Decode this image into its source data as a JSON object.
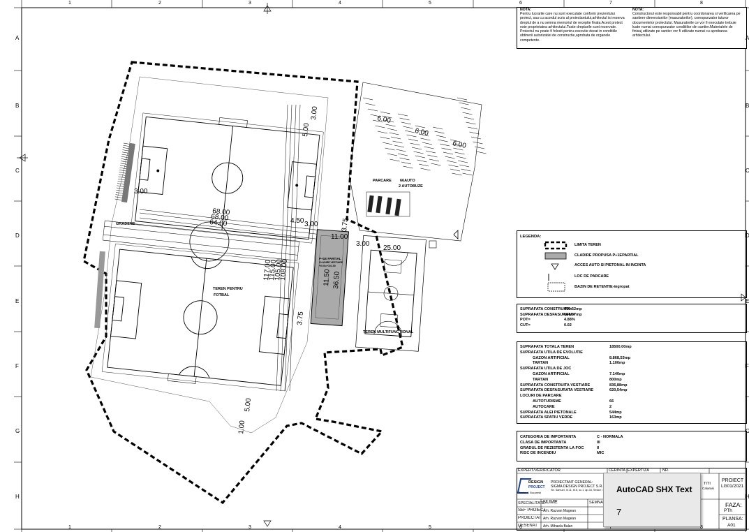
{
  "grid": {
    "columns": [
      "1",
      "2",
      "3",
      "4",
      "5",
      "6",
      "7",
      "8"
    ],
    "rows": [
      "A",
      "B",
      "C",
      "D",
      "E",
      "F",
      "G",
      "H"
    ]
  },
  "notes": {
    "left_heading": "NOTA:",
    "left_text": "Pentru lucrarile care nu sunt executate conform prezentului proiect, sau cu acordul scris al proiectantului,arhitectul isi rezerva  dreptul de a nu semna memoriul de receptie finala.Acest proiect este proprietatea arhitectului.Toate drepturile sunt rezervate. Proiectul nu poate fi folosit pentru executie decat in conditiile obtinerii autorizatiei de constructie,aprobata de organele competente.",
    "right_heading": "NOTA:",
    "right_text": "Constructorul este responsabil pentru coordonarea si verificarea pe santiere dimensiunilor (masuratorilor), corespunzator tuturor documentelor proiectului. Masuratorile ce vor fi executate trebuie luate numai corespunzator conditiilor din santier.Materialele de finisaj utilizate pe santier vor fi utilizate numai cu aprobarea arhitectului."
  },
  "plan": {
    "labels": {
      "parcare": "PARCARE",
      "auto": "66AUTO",
      "autobuze": "2 AUTOBUZE",
      "gradene": "GRADENE",
      "teren_fotbal_1": "TEREN PENTRU",
      "teren_fotbal_2": "FOTBAL",
      "teren_multi": "TEREN MULTIFUNCTIONAL",
      "cladire_1": "P+1E PARTIAL",
      "cladire_2": "CLADIRE VESTIARE",
      "cladire_3": "+0.00=+101.50"
    },
    "dims": {
      "d600a": "6.00",
      "d600b": "6.00",
      "d600c": "6.00",
      "d300a": "3.00",
      "d500a": "5.00",
      "d300b": "3.00",
      "d6800a": "68.00",
      "d6800b": "68.00",
      "d6400": "64.00",
      "d450": "4.50",
      "d300c": "3.00",
      "d375a": "3.75",
      "d1100": "11.00",
      "d300d": "3.00",
      "d2500": "25.00",
      "d11700": "117.00",
      "d11500": "115.00",
      "d10500": "105.00",
      "d10800": "108.00",
      "d1150": "11.50",
      "d3650": "36.50",
      "d375b": "3.75",
      "d500b": "5.00",
      "d100": "1.00"
    }
  },
  "legend": {
    "title": "LEGENDA:",
    "items": [
      {
        "label": "LIMITA TEREN",
        "symbol": "limit-icon"
      },
      {
        "label": "CLADIRE PROPUSA P+1EPARTIAL",
        "symbol": "building-icon"
      },
      {
        "label": "ACCES AUTO SI PIETONAL IN INCINTA",
        "symbol": "access-triangle-icon"
      },
      {
        "label": "LOC DE PARCARE",
        "symbol": "parking-line-icon"
      },
      {
        "label": "BAZIN DE RETENTIE-ingropat",
        "symbol": "basin-icon"
      }
    ]
  },
  "indicators": [
    {
      "label": "SUPRAFATA CONSTRUITA=",
      "value": "406.52mp"
    },
    {
      "label": "SUPRAFATA DESFASURATA=",
      "value": "654.67mp"
    },
    {
      "label": "POT=",
      "value": "4.88%"
    },
    {
      "label": "CUT=",
      "value": "0.02"
    }
  ],
  "surfaces": [
    {
      "label": "SUPRAFATA TOTALA TEREN",
      "value": "18500.00mp",
      "indent": false
    },
    {
      "label": "SUPRAFATA UTILA DE EVOLUTIE",
      "value": "",
      "indent": false
    },
    {
      "label": "GAZON ARTIFICIAL",
      "value": "8.868,53mp",
      "indent": true
    },
    {
      "label": "TARTAN",
      "value": "1.100mp",
      "indent": true
    },
    {
      "label": "SUPRAFATA UTILA DE JOC",
      "value": "",
      "indent": false
    },
    {
      "label": "GAZON ARTIFICIAL",
      "value": "7.140mp",
      "indent": true
    },
    {
      "label": "TARTAN",
      "value": "800mp",
      "indent": true
    },
    {
      "label": "SUPRAFATA CONSTRUITA VESTIARE",
      "value": "836,88mp",
      "indent": false
    },
    {
      "label": "SUPRAFATA DESFASURATA VESTIARE",
      "value": "620,54mp",
      "indent": false
    },
    {
      "label": "LOCURI DE PARCARE",
      "value": "",
      "indent": false
    },
    {
      "label": "AUTOTURISME",
      "value": "66",
      "indent": true
    },
    {
      "label": "AUTOCARE",
      "value": "2",
      "indent": true
    },
    {
      "label": "SUPRAFATA ALEI PIETONALE",
      "value": "544mp",
      "indent": false
    },
    {
      "label": "SUPRAFATA SPATIU VERDE",
      "value": "163mp",
      "indent": false
    }
  ],
  "classification": [
    {
      "label": "CATEGORIA DE IMPORTANTA",
      "value": "C - NORMALA"
    },
    {
      "label": "CLASA DE IMPORTANTA",
      "value": "III"
    },
    {
      "label": "GRADUL DE REZISTENTA LA FOC",
      "value": "II"
    },
    {
      "label": "RISC DE INCENDIU",
      "value": "MIC"
    }
  ],
  "title_block": {
    "expert": "EXPERT/VERIFICATOR",
    "cerinta": "CERINTA",
    "expertiza": "EXPERTIZA",
    "nr": "NR.",
    "proiectant_general": "PROIECTANT GENERAL:",
    "company": "SIGMA DESIGN PROJECT S.R.L.",
    "address": "Str. Samuel, nr.11, bl.6, sc.1, ap.34, Sector 4, B",
    "logo_name": "DESIGN",
    "logo_sub": "PROJECT",
    "logo_tag": "Sector 4, Bucuresti",
    "titlu_fragment": "TITI",
    "titlu_fragment2": "Calarasi",
    "proiect_label": "PROIECT",
    "proiect_value": "LG01/2021",
    "specialitate": "SPECIALITATE",
    "nume": "NUME",
    "semnatura": "SEMNAT",
    "sef_proiect": "SEF PROIECT",
    "sef_proiect_name": "Arh. Razvan Magean",
    "proiectat": "PROIECTAT",
    "proiectat_name": "Arh. Razvan Magean",
    "desenat": "DESENAT",
    "desenat_name": "Arh. Mihaela Balan",
    "faza_label": "FAZA:",
    "faza_value": "PTh",
    "plansa_label": "PLANSA:",
    "plansa_value": "A01"
  },
  "tooltip": {
    "title": "AutoCAD SHX Text",
    "value": "7"
  }
}
